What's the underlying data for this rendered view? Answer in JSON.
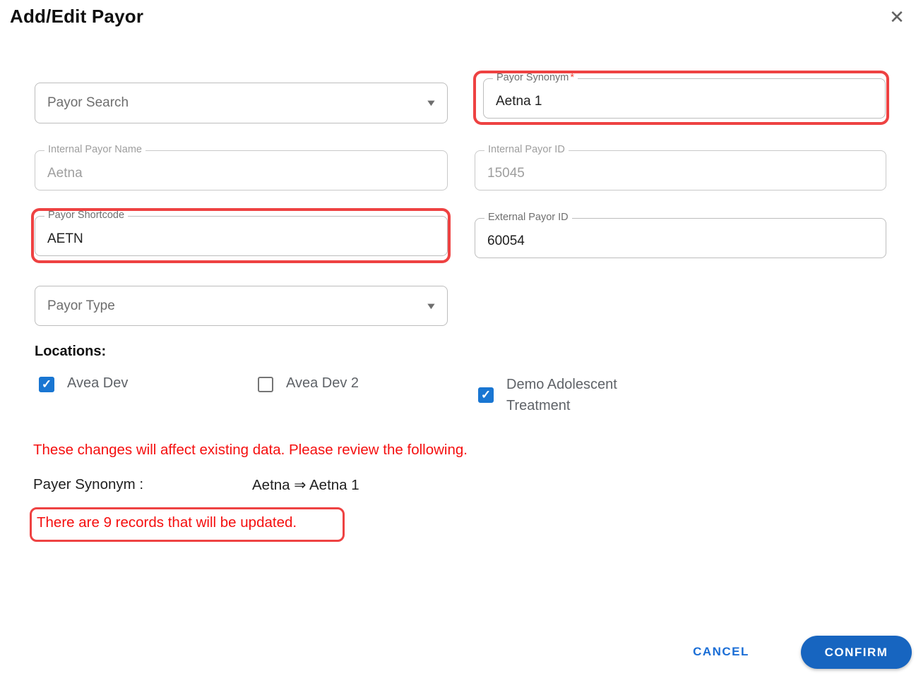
{
  "dialog": {
    "title": "Add/Edit Payor"
  },
  "icons": {
    "close": "✕",
    "dropdown": "▼",
    "check": "✓"
  },
  "fields": {
    "payor_search": {
      "placeholder": "Payor Search"
    },
    "payor_synonym": {
      "label": "Payor Synonym",
      "required_marker": "*",
      "value": "Aetna 1"
    },
    "internal_payor_name": {
      "label": "Internal Payor Name",
      "value": "Aetna"
    },
    "internal_payor_id": {
      "label": "Internal Payor ID",
      "value": "15045"
    },
    "payor_shortcode": {
      "label": "Payor Shortcode",
      "value": "AETN"
    },
    "external_payor_id": {
      "label": "External Payor ID",
      "value": "60054"
    },
    "payor_type": {
      "placeholder": "Payor Type"
    }
  },
  "locations": {
    "heading": "Locations:",
    "items": [
      {
        "label": "Avea Dev",
        "checked": true
      },
      {
        "label": "Avea Dev 2",
        "checked": false
      },
      {
        "label": "Demo Adolescent Treatment",
        "checked": true
      }
    ]
  },
  "review": {
    "warning": "These changes will affect existing data. Please review the following.",
    "change_label": "Payer Synonym :",
    "change_value": "Aetna ⇒ Aetna 1",
    "records_notice": "There are 9 records that will be updated."
  },
  "actions": {
    "cancel": "CANCEL",
    "confirm": "CONFIRM"
  },
  "colors": {
    "accent_blue": "#1765c0",
    "checkbox_blue": "#1976d2",
    "warning_red": "#f50f0f",
    "annotation_red": "#ee4242"
  }
}
